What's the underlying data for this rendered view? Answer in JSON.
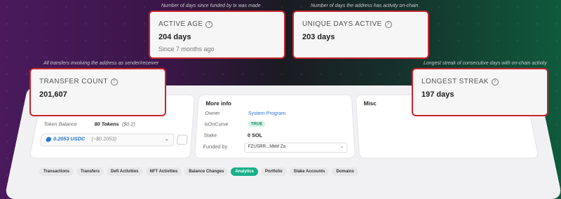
{
  "captions": {
    "active_age": "Number of days since funded by tx was made",
    "unique_days": "Number of days the address has activity on-chain",
    "transfer_count": "All transfers involving the address as sender/receiver",
    "longest_streak": "Longest streak of consecutive days with on-chain activity"
  },
  "callouts": {
    "active_age": {
      "title": "ACTIVE AGE",
      "value": "204 days",
      "sub": "Since 7 months ago"
    },
    "unique_days": {
      "title": "UNIQUE DAYS ACTIVE",
      "value": "203 days"
    },
    "transfer_count": {
      "title": "TRANSFER COUNT",
      "value": "201,607"
    },
    "longest_streak": {
      "title": "LONGEST STREAK",
      "value": "197 days"
    }
  },
  "overview": {
    "token_balance_label": "Token Balance",
    "token_balance_value": "80 Tokens",
    "token_balance_usd": "($0.2)",
    "token_select_value": "0.2053 USDC",
    "token_select_usd": "(~$0.2053)"
  },
  "more_info": {
    "title": "More info",
    "owner_label": "Owner",
    "owner_value": "System Program",
    "oncurve_label": "isOnCurve",
    "oncurve_value": "TRUE",
    "stake_label": "Stake",
    "stake_value": "0 SOL",
    "funded_label": "Funded by",
    "funded_value": "FZUSRR...Mkbf Za"
  },
  "misc": {
    "title": "Misc"
  },
  "tabs": [
    {
      "label": "Transactions",
      "active": false
    },
    {
      "label": "Transfers",
      "active": false
    },
    {
      "label": "Defi Activities",
      "active": false
    },
    {
      "label": "NFT Activities",
      "active": false
    },
    {
      "label": "Balance Changes",
      "active": false
    },
    {
      "label": "Analytics",
      "active": true
    },
    {
      "label": "Portfolio",
      "active": false
    },
    {
      "label": "Stake Accounts",
      "active": false
    },
    {
      "label": "Domains",
      "active": false
    }
  ],
  "colors": {
    "accent": "#18b08a",
    "callout_border": "#c7262e"
  }
}
